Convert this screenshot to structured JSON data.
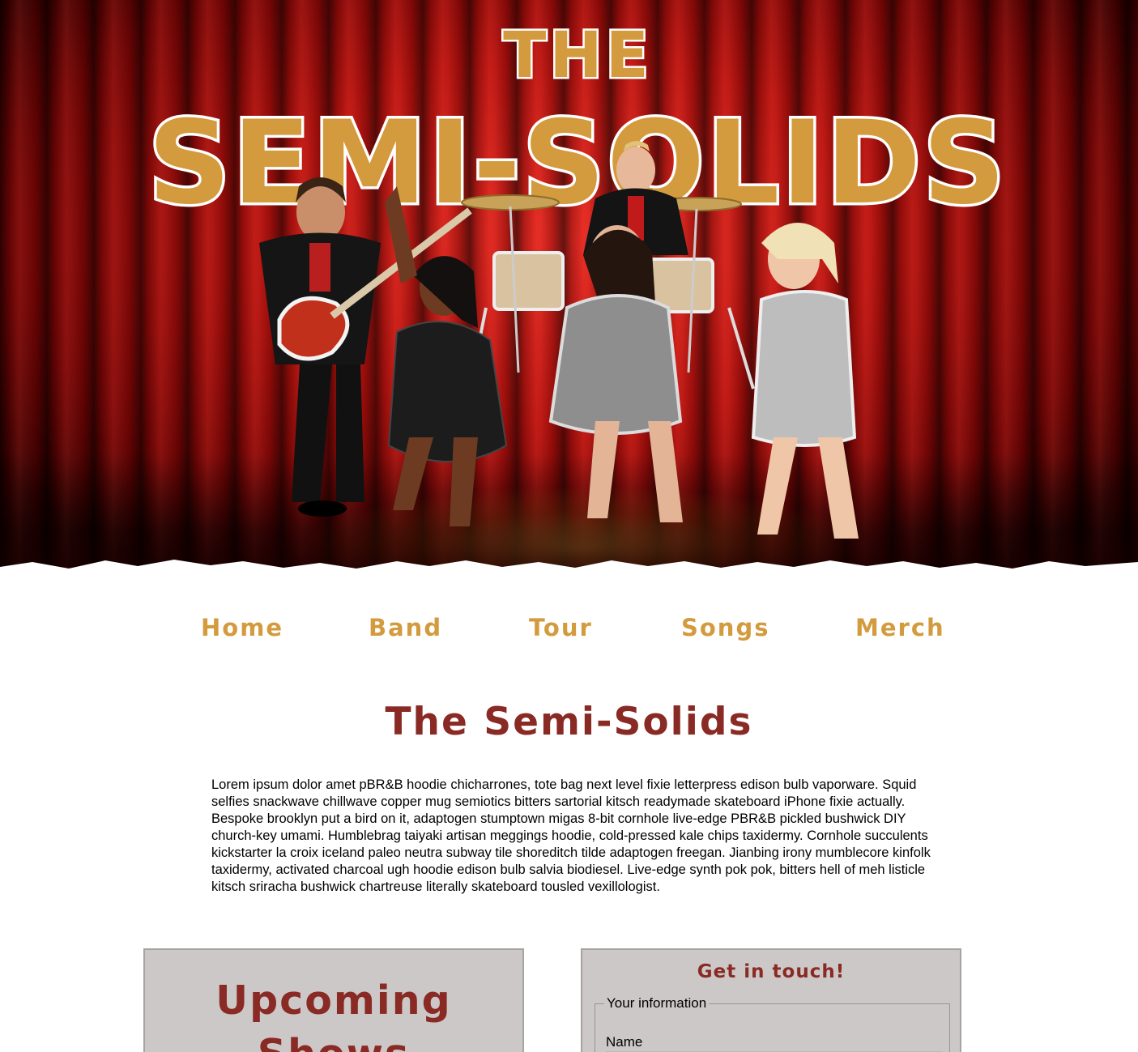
{
  "hero": {
    "logo_top": "THE",
    "logo_main": "SEMI-SOLIDS"
  },
  "nav": {
    "items": [
      {
        "label": "Home"
      },
      {
        "label": "Band"
      },
      {
        "label": "Tour"
      },
      {
        "label": "Songs"
      },
      {
        "label": "Merch"
      }
    ]
  },
  "main": {
    "title": "The Semi-Solids",
    "intro": "Lorem ipsum dolor amet pBR&B hoodie chicharrones, tote bag next level fixie letterpress edison bulb vaporware. Squid selfies snackwave chillwave copper mug semiotics bitters sartorial kitsch readymade skateboard iPhone fixie actually. Bespoke brooklyn put a bird on it, adaptogen stumptown migas 8-bit cornhole live-edge PBR&B pickled bushwick DIY church-key umami. Humblebrag taiyaki artisan meggings hoodie, cold-pressed kale chips taxidermy. Cornhole succulents kickstarter la croix iceland paleo neutra subway tile shoreditch tilde adaptogen freegan. Jianbing irony mumblecore kinfolk taxidermy, activated charcoal ugh hoodie edison bulb salvia biodiesel. Live-edge synth pok pok, bitters hell of meh listicle kitsch sriracha bushwick chartreuse literally skateboard tousled vexillologist."
  },
  "shows": {
    "title": "Upcoming Shows"
  },
  "contact": {
    "title": "Get in touch!",
    "fieldset_legend": "Your information",
    "name_label": "Name",
    "name_value": ""
  },
  "colors": {
    "gold": "#d39b3d",
    "maroon": "#8a2a25",
    "panel": "#ccc8c7",
    "curtain": "#b5130f"
  }
}
